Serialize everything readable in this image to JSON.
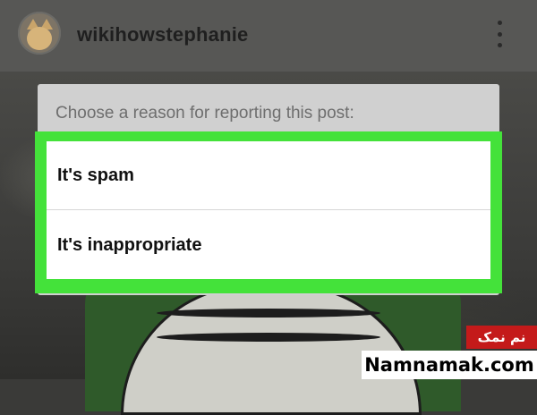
{
  "header": {
    "username": "wikihowstephanie",
    "avatar_icon": "cat-avatar",
    "menu_icon": "more-vertical-icon"
  },
  "dialog": {
    "title": "Choose a reason for reporting this post:",
    "options": [
      {
        "label": "It's spam"
      },
      {
        "label": "It's inappropriate"
      }
    ],
    "highlight_color": "#44e23a"
  },
  "watermark": {
    "fa_text": "نم نمک",
    "en_text": "Namnamak.com",
    "fa_bg_color": "#c41a1a"
  }
}
